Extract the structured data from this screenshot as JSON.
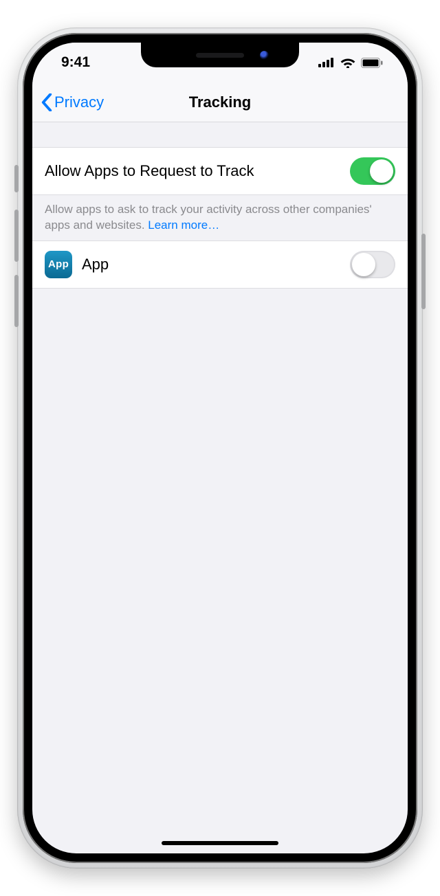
{
  "status": {
    "time": "9:41"
  },
  "nav": {
    "back_label": "Privacy",
    "title": "Tracking"
  },
  "main_toggle": {
    "label": "Allow Apps to Request to Track",
    "on": true
  },
  "footer": {
    "text": "Allow apps to ask to track your activity across other companies' apps and websites. ",
    "link": "Learn more…"
  },
  "apps": [
    {
      "icon_text": "App",
      "name": "App",
      "on": false
    }
  ]
}
